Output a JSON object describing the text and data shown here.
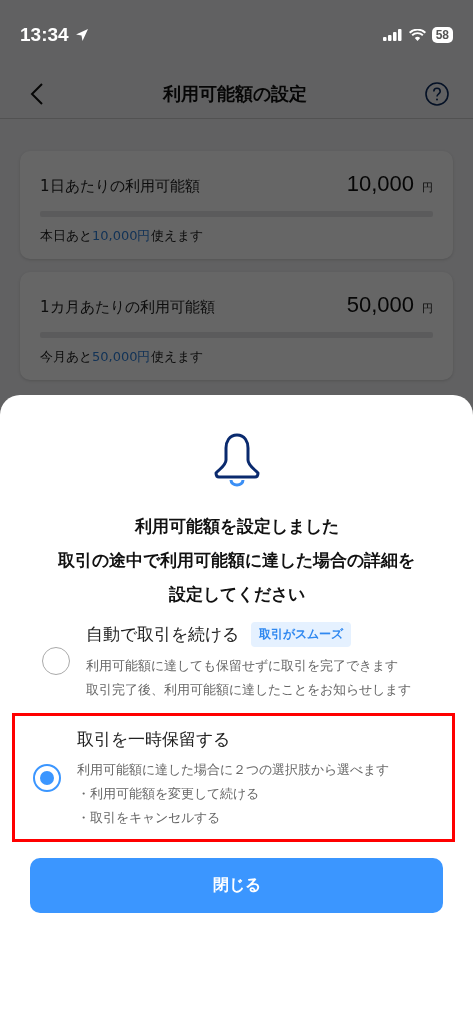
{
  "status_bar": {
    "time": "13:34",
    "battery": "58"
  },
  "nav": {
    "title": "利用可能額の設定"
  },
  "limits": [
    {
      "label": "1日あたりの利用可能額",
      "amount": "10,000",
      "unit": "円",
      "remaining": {
        "prefix": "本日あと",
        "amount": "10,000円",
        "suffix": "使えます"
      }
    },
    {
      "label": "1カ月あたりの利用可能額",
      "amount": "50,000",
      "unit": "円",
      "remaining": {
        "prefix": "今月あと",
        "amount": "50,000円",
        "suffix": "使えます"
      }
    }
  ],
  "sheet": {
    "message": [
      "利用可能額を設定しました",
      "取引の途中で利用可能額に達した場合の詳細を",
      "設定してください"
    ],
    "options": [
      {
        "title": "自動で取引を続ける",
        "badge": "取引がスムーズ",
        "lines": [
          "利用可能額に達しても保留せずに取引を完了できます",
          "取引完了後、利用可能額に達したことをお知らせします"
        ],
        "selected": false,
        "highlighted": false
      },
      {
        "title": "取引を一時保留する",
        "lines": [
          "利用可能額に達した場合に２つの選択肢から選べます",
          "・利用可能額を変更して続ける",
          "・取引をキャンセルする"
        ],
        "selected": true,
        "highlighted": true
      }
    ],
    "close_button": "閉じる"
  }
}
